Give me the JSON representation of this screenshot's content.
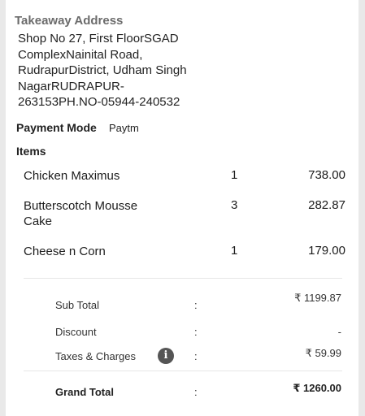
{
  "takeaway": {
    "title": "Takeaway Address",
    "address": "Shop No 27, First FloorSGAD ComplexNainital Road, RudrapurDistrict, Udham Singh NagarRUDRAPUR-263153PH.NO-05944-240532"
  },
  "payment": {
    "label": "Payment Mode",
    "value": "Paytm"
  },
  "items": {
    "title": "Items",
    "rows": [
      {
        "name": "Chicken Maximus",
        "qty": "1",
        "price": "738.00"
      },
      {
        "name": "Butterscotch Mousse Cake",
        "qty": "3",
        "price": "282.87"
      },
      {
        "name": "Cheese n Corn",
        "qty": "1",
        "price": "179.00"
      }
    ]
  },
  "summary": {
    "colon": ":",
    "subtotal_label": "Sub Total",
    "subtotal_value": "₹ 1199.87",
    "discount_label": "Discount",
    "discount_value": "-",
    "taxes_label": "Taxes & Charges",
    "taxes_value": "₹ 59.99",
    "info_glyph": "i",
    "grand_label": "Grand Total",
    "grand_value": "₹ 1260.00"
  }
}
